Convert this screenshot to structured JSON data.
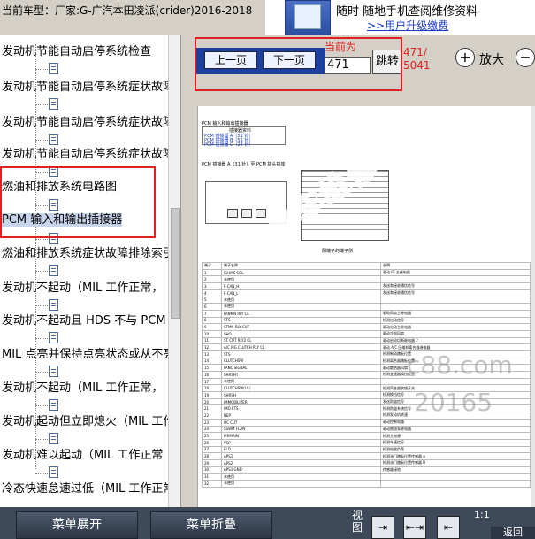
{
  "header": {
    "car_model": "当前车型：厂家:G-广汽本田凌派(crider)2016-2018",
    "promo_line1": "随时 随地手机查阅维修资料",
    "promo_line2": ">>用户升级缴费"
  },
  "tree": {
    "items": [
      {
        "label": "发动机节能自动启停系统检查"
      },
      {
        "label": "发动机节能自动启停系统症状故障"
      },
      {
        "label": "发动机节能自动启停系统症状故障"
      },
      {
        "label": "发动机节能自动启停系统症状故障"
      },
      {
        "label": "燃油和排放系统电路图"
      },
      {
        "label": "PCM 输入和输出插接器"
      },
      {
        "label": "燃油和排放系统症状故障排除索引"
      },
      {
        "label": "发动机不起动（MIL 工作正常，"
      },
      {
        "label": "发动机不起动且 HDS 不与 PCM"
      },
      {
        "label": "MIL 点亮并保持点亮状态或从不亮"
      },
      {
        "label": "发动机不起动（MIL 工作正常，"
      },
      {
        "label": "发动机起动但立即熄火（MIL 工作"
      },
      {
        "label": "发动机难以起动（MIL 工作正常"
      },
      {
        "label": "冷态快速怠速过低（MIL 工作正常"
      }
    ]
  },
  "toolbar": {
    "prev_label": "上一页",
    "next_label": "下一页",
    "current_label": "当前为",
    "page_value": "471",
    "jump_label": "跳转",
    "page_count": "471/\n5041",
    "zoom_in_label": "放大",
    "zoom_in_glyph": "+",
    "zoom_out_glyph": "−"
  },
  "document": {
    "title": "PCM 输入和输出插接器",
    "table_header": "插接器资料",
    "link1": "PCM 插接器 A（31 针）",
    "link2": "PCM 插接器 B（51 针）",
    "link3": "PCM 插接器 C（24 针）",
    "connector_title": "PCM 插接器 A（31 针）至 PCM 插头插座",
    "connector_caption": "阴端子的端子侧",
    "table_columns": [
      "端子",
      "端子名称",
      "说明"
    ],
    "rows": [
      [
        "1",
        "IGHMS SOL",
        "驱动 IG 主继电器"
      ],
      [
        "2",
        "未使用",
        ""
      ],
      [
        "3",
        "F-CAN_H",
        "发送和接收通信信号"
      ],
      [
        "4",
        "F-CAN_L",
        "发送和接收通信信号"
      ],
      [
        "5",
        "未使用",
        ""
      ],
      [
        "6",
        "未使用",
        ""
      ],
      [
        "7",
        "FANMN RLY CL",
        "驱动风扇主继电器"
      ],
      [
        "8",
        "STS",
        "检测启动信号"
      ],
      [
        "9",
        "STMN RLY CUT",
        "驱动启动主继电器"
      ],
      [
        "10",
        "SHO",
        "驱动冷却风扇"
      ],
      [
        "11",
        "ST CUT RLY2 CL",
        "驱动启动切断继电器 2"
      ],
      [
        "12",
        "A/C MG CLUTCH RLY CL",
        "驱动 A/C 压缩机离合器继电器"
      ],
      [
        "13",
        "STS",
        "检测制动踏板位置"
      ],
      [
        "14",
        "CLUTCHSW",
        "检测离合器踏板位置"
      ],
      [
        "15",
        "FANC SIGNAL",
        "驱动散热器风扇"
      ],
      [
        "16",
        "SHRSHT",
        "检测变速器换挡位置"
      ],
      [
        "17",
        "未使用",
        ""
      ],
      [
        "18",
        "CLUTCHSW(UL)",
        "检测离合器联锁开关"
      ],
      [
        "19",
        "SHRSH",
        "检测换挡信号"
      ],
      [
        "20",
        "IMMOBILIZER",
        "发送防盗信号"
      ],
      [
        "21",
        "IMO ETS",
        "检测防盗系统信号"
      ],
      [
        "22",
        "NEP",
        "检测发动机转速"
      ],
      [
        "23",
        "OC CUT",
        "驱动控制电路"
      ],
      [
        "24",
        "SSWM FLAN",
        "驱动燃油泵继电器"
      ],
      [
        "25",
        "PIRMAIN",
        "检测主电源"
      ],
      [
        "26",
        "VSP",
        "检测车速信号"
      ],
      [
        "27",
        "ELD",
        "检测电器负载"
      ],
      [
        "28",
        "APS1",
        "检测油门踏板位置传感器 A"
      ],
      [
        "29",
        "APS2",
        "检测油门踏板位置传感器 B"
      ],
      [
        "30",
        "APS1 GND",
        "传感器接地"
      ],
      [
        "31",
        "未使用",
        ""
      ],
      [
        "32",
        "未使用",
        ""
      ]
    ]
  },
  "watermark": {
    "logo_text": "易车维修平台",
    "url_fragment": "c88.com",
    "qq_fragment": "20165"
  },
  "bottom": {
    "expand_label": "菜单展开",
    "collapse_label": "菜单折叠",
    "view_label": "视图",
    "ratio_label": "1:1",
    "btn_fit": "⇥",
    "btn_fit_both": "⇤⇥",
    "btn_back": "⇤",
    "right_label": "返回"
  },
  "colors": {
    "accent_red": "#e02020",
    "nav_blue": "#1d3f9e",
    "watermark_blue": "#2a3dd0",
    "bottom_bar": "#3e4a5a"
  }
}
